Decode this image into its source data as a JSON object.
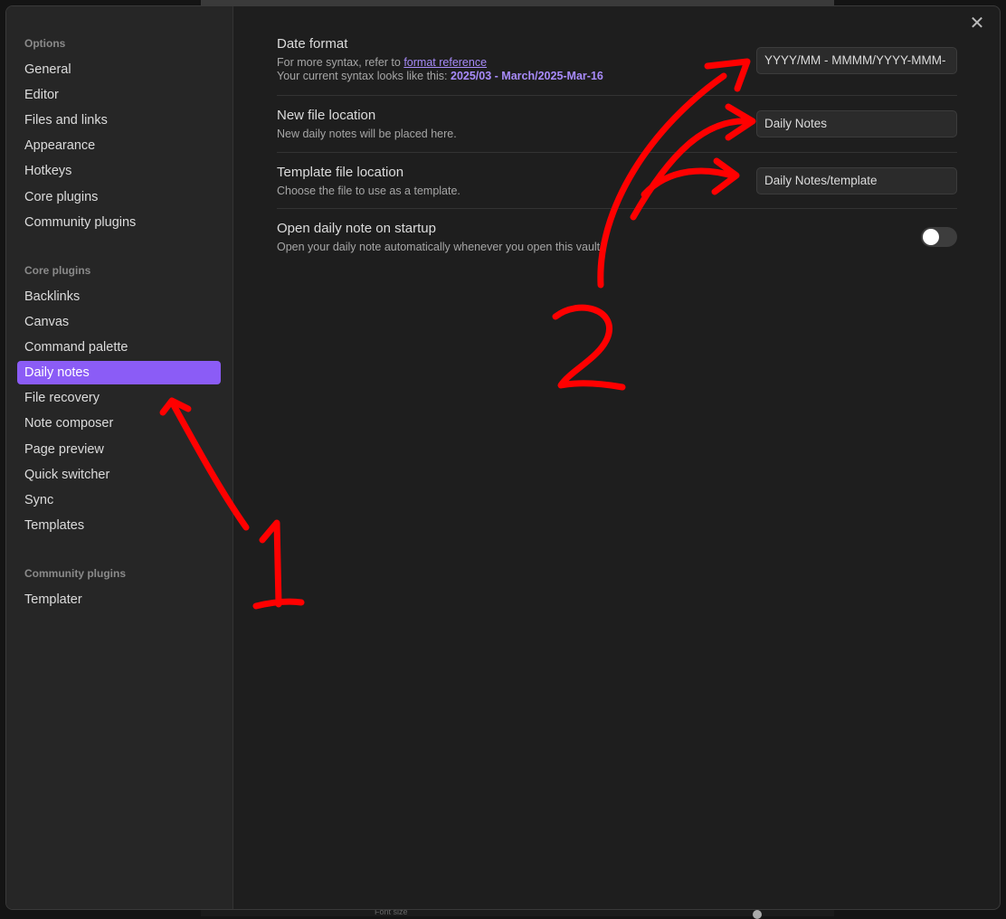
{
  "sidebar": {
    "options_title": "Options",
    "options_items": [
      "General",
      "Editor",
      "Files and links",
      "Appearance",
      "Hotkeys",
      "Core plugins",
      "Community plugins"
    ],
    "core_title": "Core plugins",
    "core_items": [
      "Backlinks",
      "Canvas",
      "Command palette",
      "Daily notes",
      "File recovery",
      "Note composer",
      "Page preview",
      "Quick switcher",
      "Sync",
      "Templates"
    ],
    "active_item": "Daily notes",
    "community_title": "Community plugins",
    "community_items": [
      "Templater"
    ]
  },
  "settings": {
    "date_format": {
      "name": "Date format",
      "desc_prefix": "For more syntax, refer to ",
      "link": "format reference",
      "syntax_prefix": "Your current syntax looks like this: ",
      "syntax_value": "2025/03 - March/2025-Mar-16",
      "value": "YYYY/MM - MMMM/YYYY-MMM-"
    },
    "new_file_location": {
      "name": "New file location",
      "desc": "New daily notes will be placed here.",
      "value": "Daily Notes"
    },
    "template_file_location": {
      "name": "Template file location",
      "desc": "Choose the file to use as a template.",
      "value": "Daily Notes/template"
    },
    "open_on_startup": {
      "name": "Open daily note on startup",
      "desc": "Open your daily note automatically whenever you open this vault.",
      "enabled": false
    }
  },
  "close_icon": "close-icon",
  "backdrop": {
    "font_size_label": "Font size"
  },
  "colors": {
    "accent": "#8b5cf6",
    "annotation": "#ff0000"
  }
}
